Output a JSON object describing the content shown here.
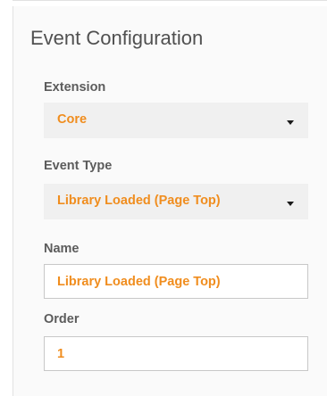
{
  "panel": {
    "title": "Event Configuration"
  },
  "extension": {
    "label": "Extension",
    "selected": "Core"
  },
  "event_type": {
    "label": "Event Type",
    "selected": "Library Loaded (Page Top)"
  },
  "name": {
    "label": "Name",
    "value": "Library Loaded (Page Top)"
  },
  "order": {
    "label": "Order",
    "value": "1"
  },
  "colors": {
    "accent": "#f08d1e",
    "label_text": "#5c5c5c",
    "panel_bg": "#fafafa",
    "select_bg": "#f0f0f0"
  },
  "icons": {
    "dropdown": "caret-down-icon"
  }
}
